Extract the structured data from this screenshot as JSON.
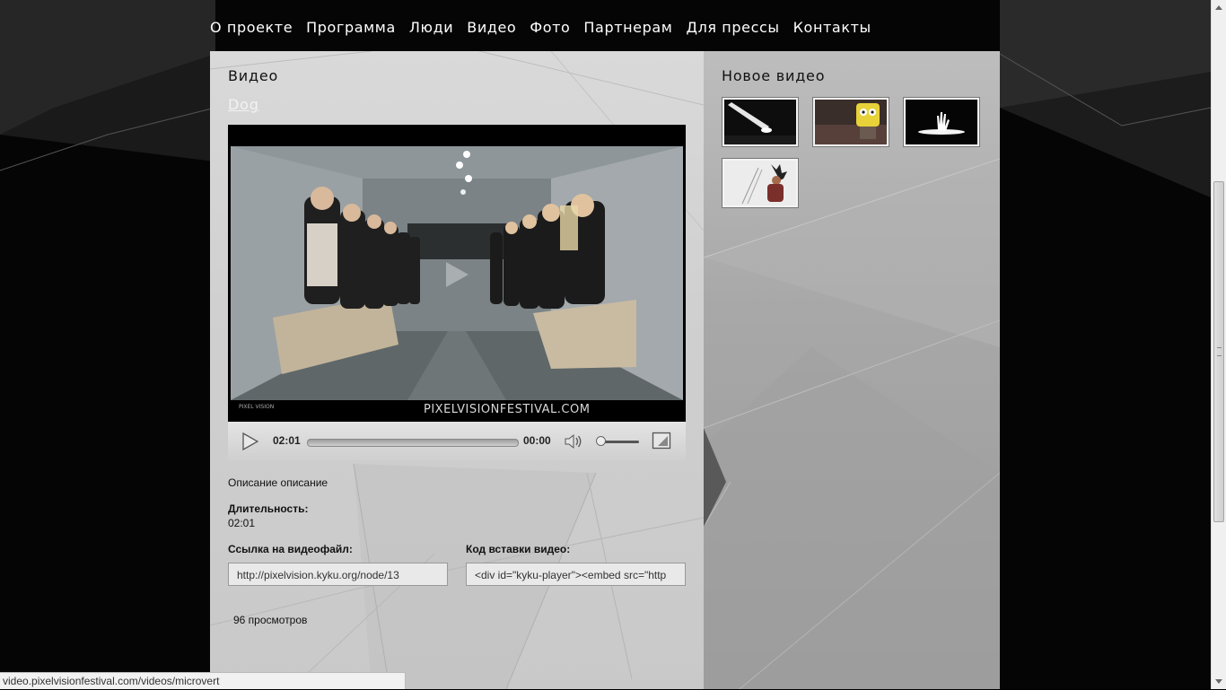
{
  "nav": {
    "items": [
      {
        "label": "О проекте"
      },
      {
        "label": "Программа"
      },
      {
        "label": "Люди"
      },
      {
        "label": "Видео"
      },
      {
        "label": "Фото"
      },
      {
        "label": "Партнерам"
      },
      {
        "label": "Для прессы"
      },
      {
        "label": "Контакты"
      }
    ]
  },
  "main": {
    "section_title": "Видео",
    "video_title": "Dog",
    "player": {
      "watermark": "PIXELVISIONFESTIVAL.COM",
      "logo_text": "PIXEL VISION",
      "duration_time": "02:01",
      "current_time": "00:00",
      "progress_fraction": 0.0,
      "volume_fraction": 0.1
    },
    "description": "Описание описание",
    "duration_label": "Длительность:",
    "duration_value": "02:01",
    "file_link_label": "Ссылка на видеофайл:",
    "file_link_value": "http://pixelvision.kyku.org/node/13",
    "embed_label": "Код вставки видео:",
    "embed_value": "<div id=\"kyku-player\"><embed  src=\"http",
    "views": "96 просмотров"
  },
  "sidebar": {
    "title": "Новое видео",
    "thumbnails": [
      {
        "name": "thumb-light-beam"
      },
      {
        "name": "thumb-sponge-character"
      },
      {
        "name": "thumb-hand-glow"
      },
      {
        "name": "thumb-figure-sculpture"
      }
    ]
  },
  "statusbar": {
    "url": "video.pixelvisionfestival.com/videos/microvert"
  },
  "colors": {
    "page_bg": "#000000",
    "left_panel": "#d3d3d3",
    "right_panel": "#a9a9a9",
    "link": "#f2f2f2"
  }
}
